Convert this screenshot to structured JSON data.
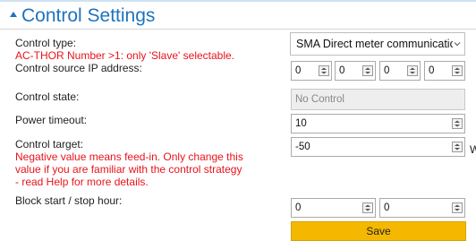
{
  "header": {
    "title": "Control Settings"
  },
  "rows": {
    "control_type": {
      "label": "Control type:",
      "warning": "AC-THOR Number >1: only 'Slave' selectable.",
      "selected": "SMA Direct meter communication"
    },
    "source_ip": {
      "label": "Control source IP address:",
      "octets": [
        "0",
        "0",
        "0",
        "0"
      ]
    },
    "control_state": {
      "label": "Control state:",
      "value": "No Control"
    },
    "power_timeout": {
      "label": "Power timeout:",
      "value": "10"
    },
    "control_target": {
      "label": "Control target:",
      "warning_lines": [
        "Negative value means feed-in. Only change this",
        "value if you are familiar with the control strategy",
        "- read Help for more details."
      ],
      "value": "-50",
      "unit": "W"
    },
    "block_hours": {
      "label": "Block start / stop hour:",
      "start": "0",
      "stop": "0"
    }
  },
  "save_label": "Save",
  "colors": {
    "title": "#1e73be",
    "warning": "#e8131b",
    "save_button": "#f5b800"
  },
  "icons": {
    "collapse": "triangle-up-icon",
    "spinner": "spinner-icon",
    "dropdown": "chevron-down-icon"
  }
}
